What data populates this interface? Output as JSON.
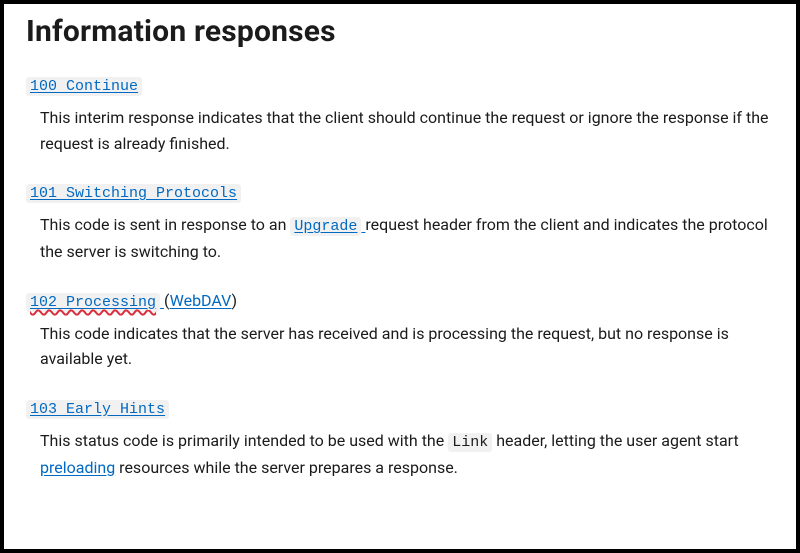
{
  "heading": "Information responses",
  "items": [
    {
      "code_label": "100 Continue",
      "deprecated": false,
      "extra_link": null,
      "description": {
        "pre": "This interim response indicates that the client should continue the request or ignore the response if the request is already finished.",
        "inline_code": null,
        "mid": "",
        "link": null,
        "post": ""
      }
    },
    {
      "code_label": "101 Switching Protocols",
      "deprecated": false,
      "extra_link": null,
      "description": {
        "pre": "This code is sent in response to an ",
        "inline_code": "Upgrade",
        "mid": " request header from the client and indicates the protocol the server is switching to.",
        "link": null,
        "post": ""
      }
    },
    {
      "code_label": "102 Processing",
      "deprecated": true,
      "extra_link": "WebDAV",
      "description": {
        "pre": "This code indicates that the server has received and is processing the request, but no response is available yet.",
        "inline_code": null,
        "mid": "",
        "link": null,
        "post": ""
      }
    },
    {
      "code_label": "103 Early Hints",
      "deprecated": false,
      "extra_link": null,
      "description": {
        "pre": "This status code is primarily intended to be used with the ",
        "inline_code": "Link",
        "mid": " header, letting the user agent start ",
        "link": "preloading",
        "post": " resources while the server prepares a response."
      }
    }
  ]
}
